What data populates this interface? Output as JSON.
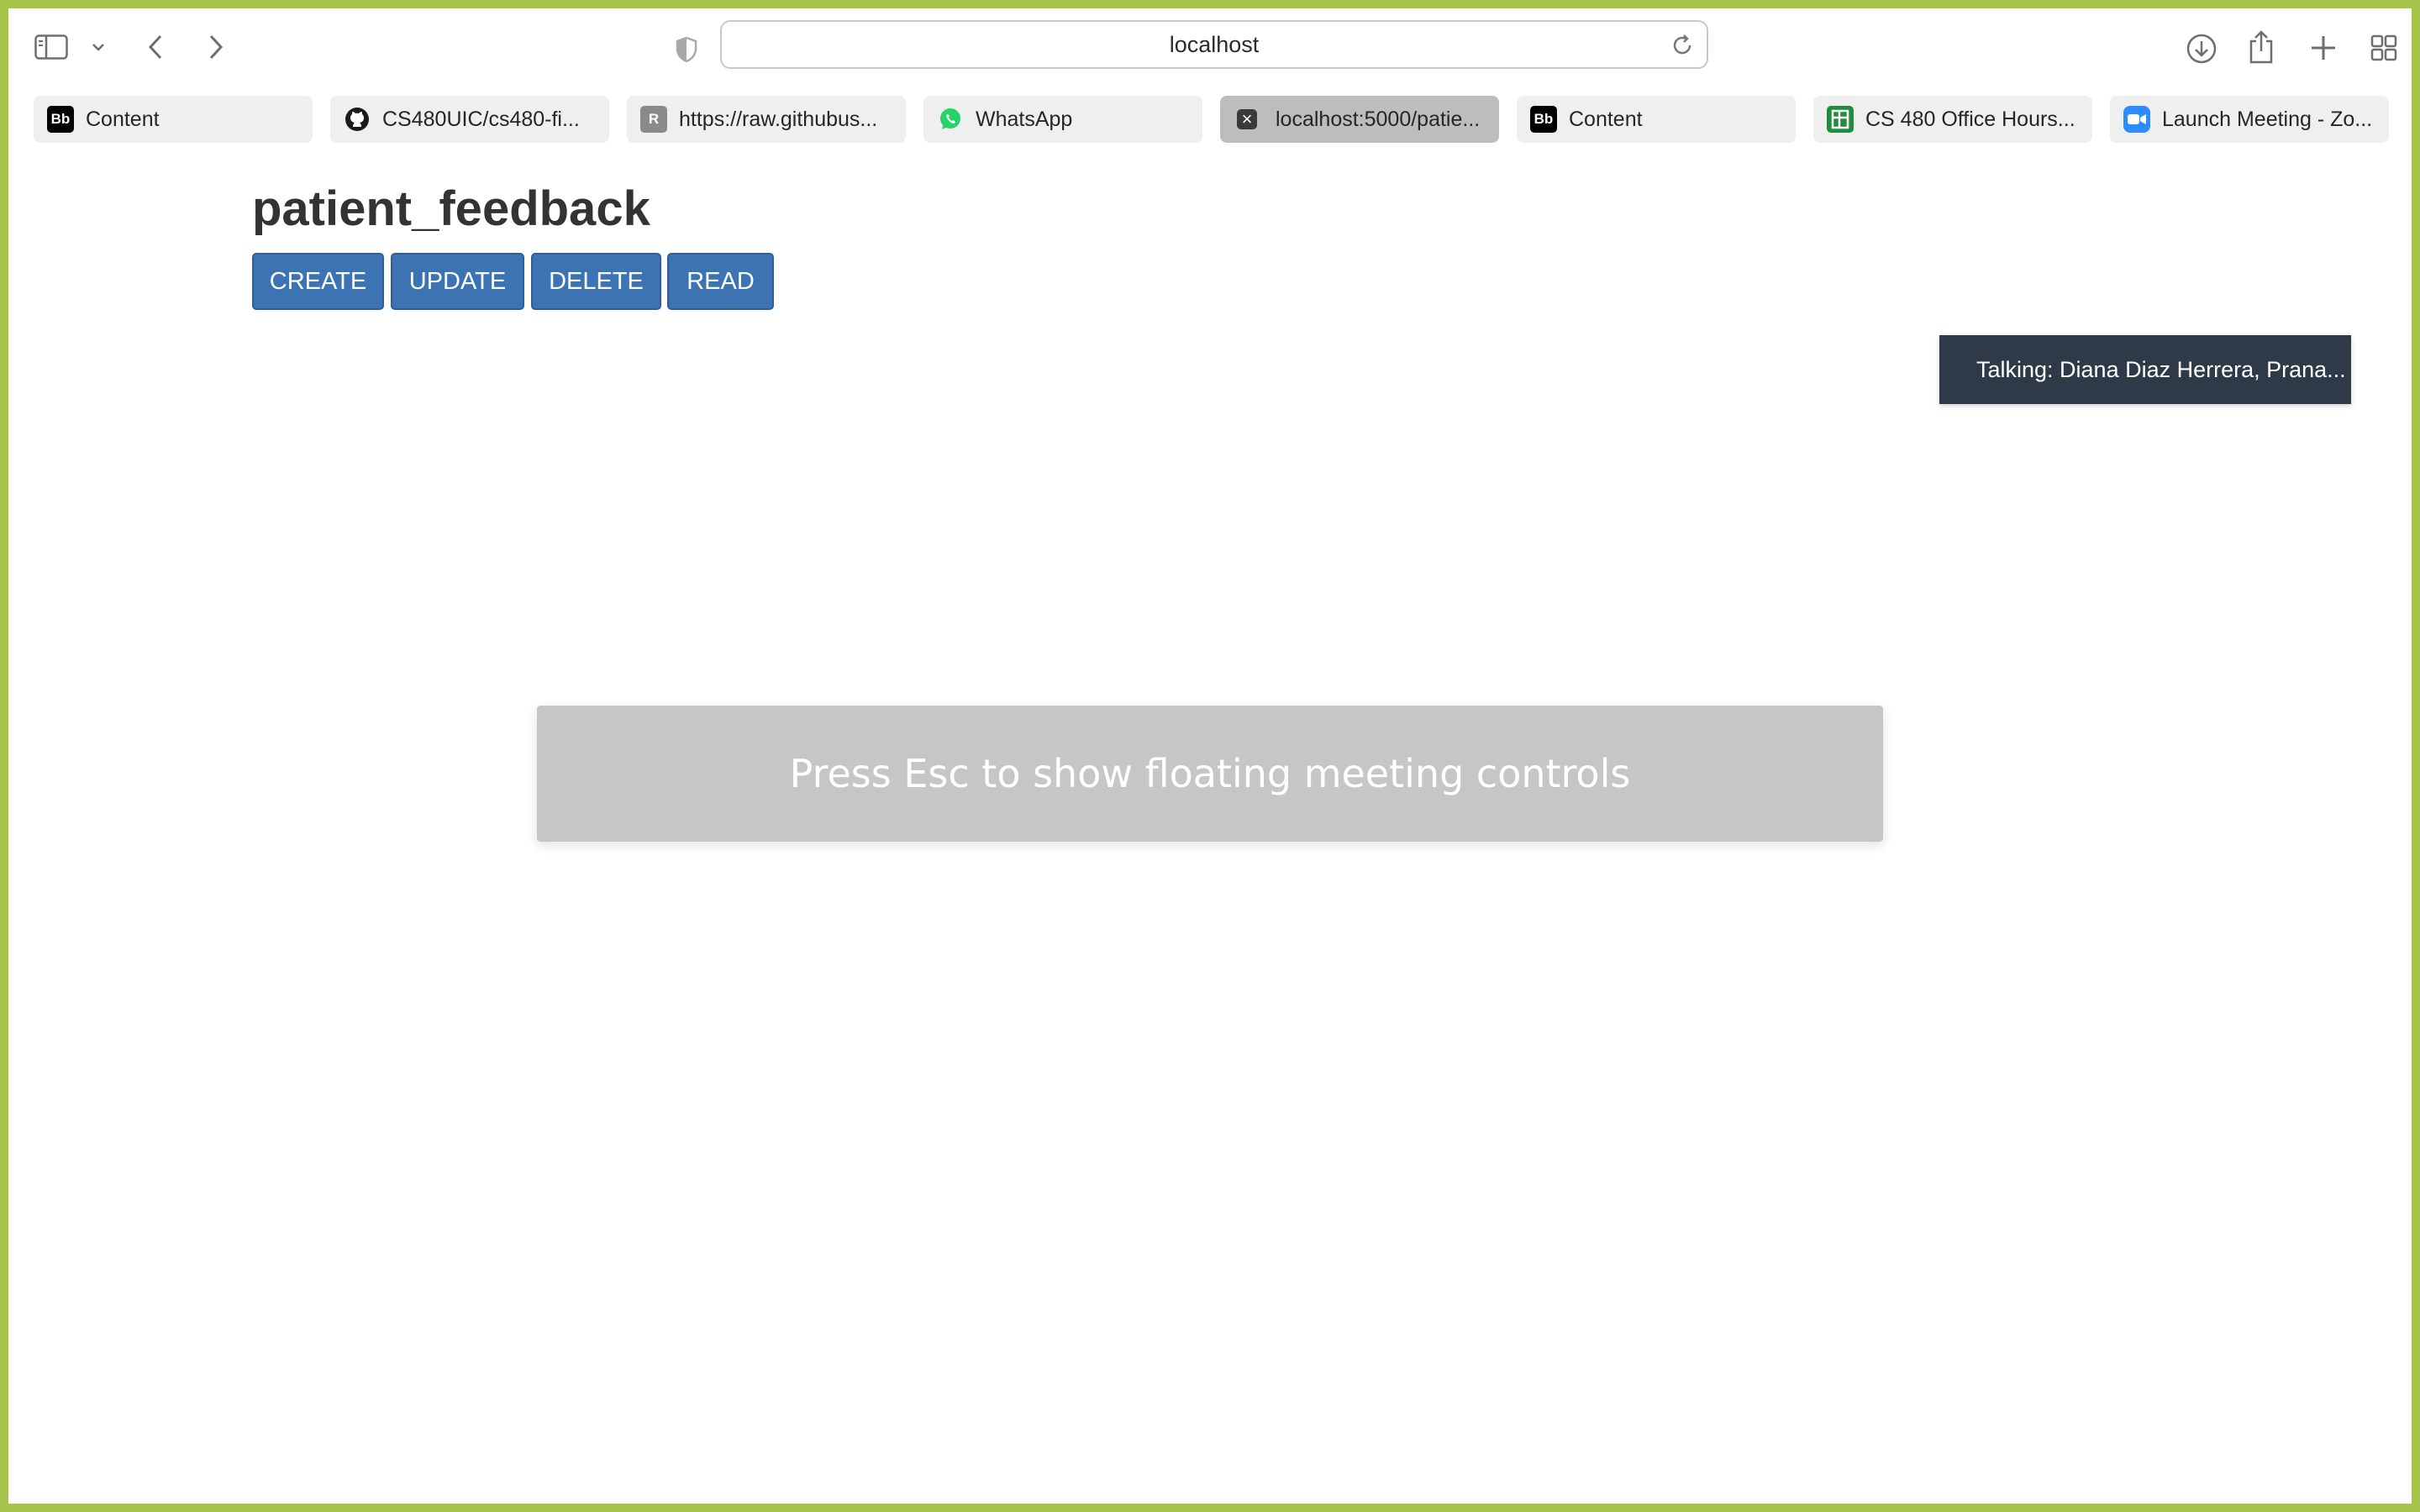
{
  "browser": {
    "url": "localhost",
    "tabs": [
      {
        "label": "Content",
        "favicon": "Bb",
        "favicon_color": "#000000",
        "icon": "blackboard-icon"
      },
      {
        "label": "CS480UIC/cs480-fi...",
        "favicon": "",
        "favicon_color": "#ffffff",
        "icon": "github-icon"
      },
      {
        "label": "https://raw.githubus...",
        "favicon": "R",
        "favicon_color": "#8a8a8a",
        "icon": "raw-github-icon"
      },
      {
        "label": "WhatsApp",
        "favicon": "",
        "favicon_color": "#25d366",
        "icon": "whatsapp-icon"
      },
      {
        "label": "localhost:5000/patie...",
        "favicon": "×",
        "favicon_color": "#3a3a3a",
        "icon": "localhost-icon",
        "active": true
      },
      {
        "label": "Content",
        "favicon": "Bb",
        "favicon_color": "#000000",
        "icon": "blackboard-icon"
      },
      {
        "label": "CS 480 Office Hours...",
        "favicon": "",
        "favicon_color": "#1e8e3e",
        "icon": "google-sheets-icon"
      },
      {
        "label": "Launch Meeting - Zo...",
        "favicon": "",
        "favicon_color": "#2d8cff",
        "icon": "zoom-icon"
      }
    ]
  },
  "page": {
    "title": "patient_feedback",
    "buttons": {
      "create": "CREATE",
      "update": "UPDATE",
      "delete": "DELETE",
      "read": "READ"
    }
  },
  "zoom_overlay": {
    "talking": "Talking: Diana Diaz Herrera, Prana...",
    "esc_hint": "Press Esc to show floating meeting controls"
  },
  "colors": {
    "window_border": "#a4c44a",
    "button_bg": "#3c73b3",
    "active_tab": "#bdbdbd",
    "talking_bg": "#2f3a48"
  }
}
